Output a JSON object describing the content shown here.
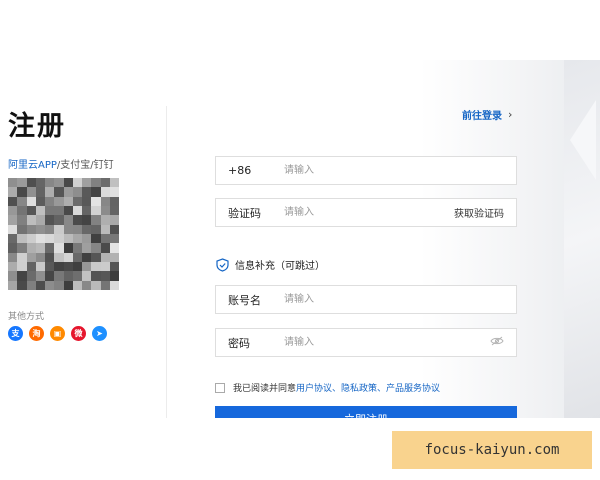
{
  "page": {
    "title": "注册",
    "login_link": "前往登录",
    "apps": {
      "prefix": "阿里云APP",
      "rest": "/支付宝/钉钉"
    },
    "other_methods": "其他方式",
    "social_icons": [
      {
        "name": "alipay-icon",
        "glyph": "支",
        "color": "#1677ff"
      },
      {
        "name": "taobao-icon",
        "glyph": "淘",
        "color": "#ff6a00"
      },
      {
        "name": "tmall-login-icon",
        "glyph": "▣",
        "color": "#ff8a00"
      },
      {
        "name": "weibo-icon",
        "glyph": "微",
        "color": "#e6162d"
      },
      {
        "name": "dingtalk-icon",
        "glyph": "➤",
        "color": "#1e90ff"
      }
    ]
  },
  "form": {
    "phone": {
      "prefix": "+86",
      "placeholder": "请输入"
    },
    "code": {
      "label": "验证码",
      "placeholder": "请输入",
      "action": "获取验证码"
    },
    "supplement": {
      "icon": "shield-check-icon",
      "text": "信息补充（可跳过）"
    },
    "account": {
      "label": "账号名",
      "placeholder": "请输入"
    },
    "password": {
      "label": "密码",
      "placeholder": "请输入",
      "icon": "eye-icon"
    },
    "agreement": {
      "prefix": "我已阅读并同意",
      "links": "用户协议、隐私政策、产品服务协议"
    },
    "submit_label": "立即注册"
  },
  "watermark": "focus-kaiyun.com"
}
